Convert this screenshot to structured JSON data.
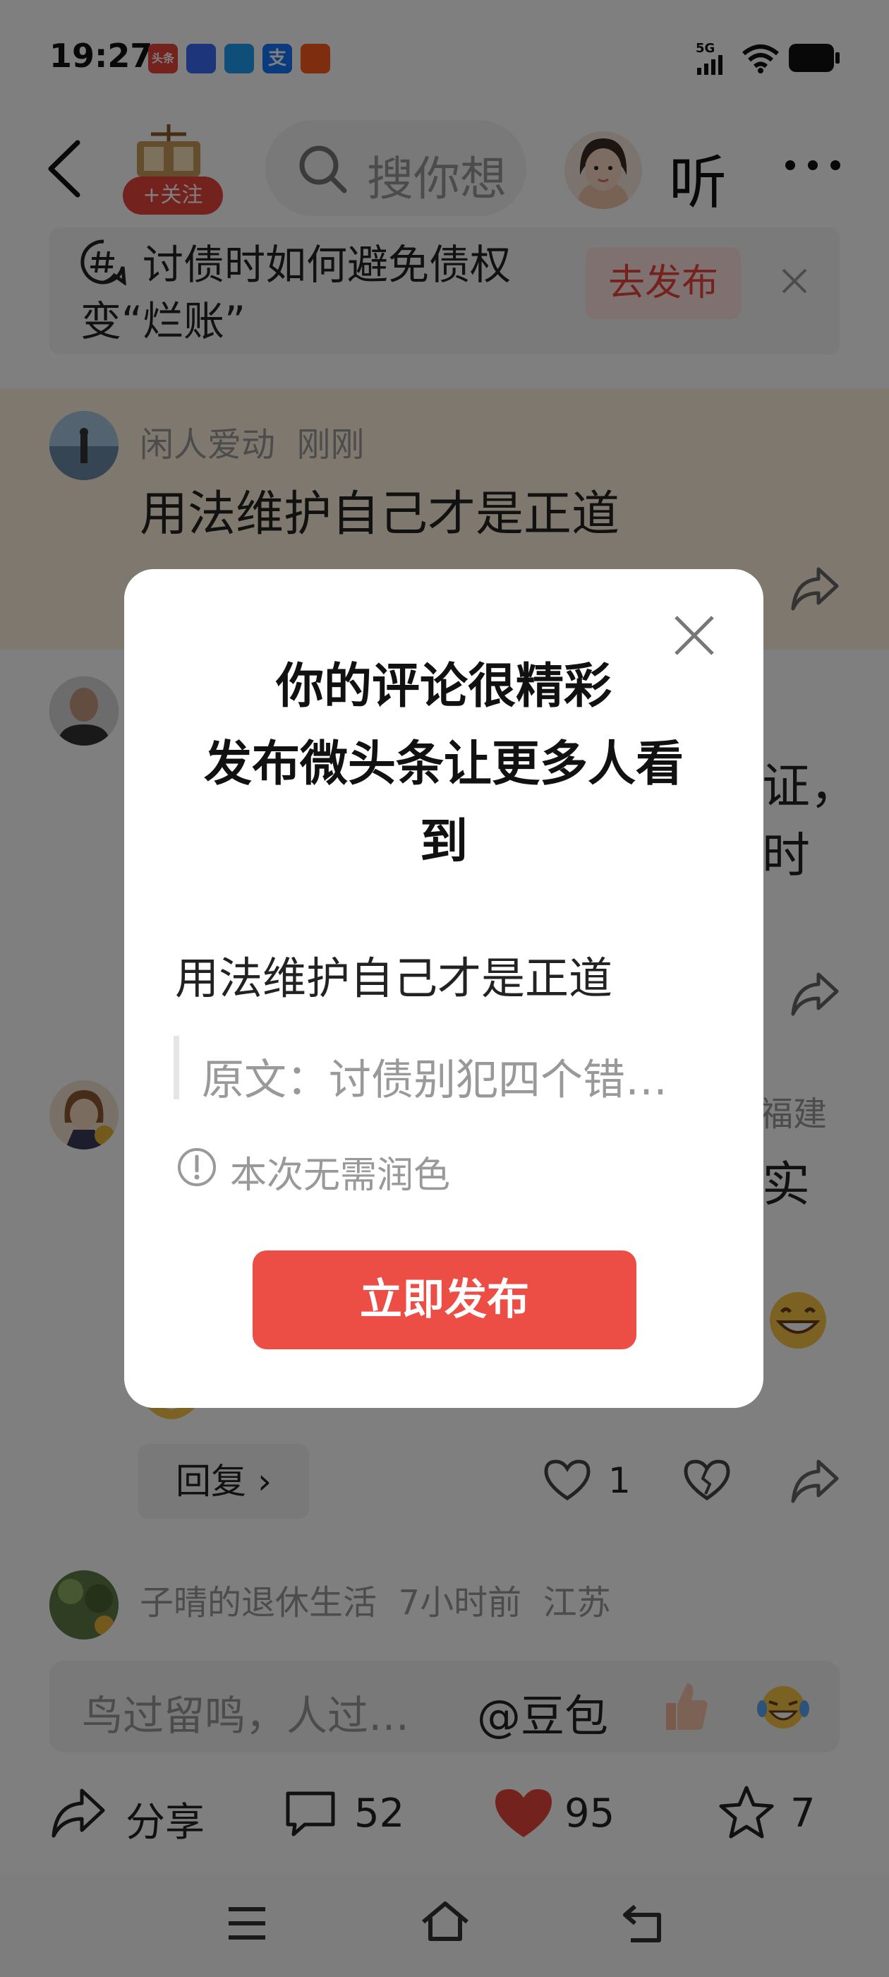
{
  "status_bar": {
    "time": "19:27",
    "network": "5G",
    "app_badges": [
      {
        "name": "toutiao",
        "label": "头条",
        "color": "#e8443a"
      },
      {
        "name": "baidu",
        "label": "",
        "color": "#3b6cf6"
      },
      {
        "name": "msg",
        "label": "",
        "color": "#1f9df0"
      },
      {
        "name": "alipay",
        "label": "支",
        "color": "#1677ff"
      },
      {
        "name": "taobao",
        "label": "",
        "color": "#ff5a1f"
      }
    ]
  },
  "header": {
    "follow_label": "+关注",
    "search_placeholder": "搜你想",
    "listen_label": "听"
  },
  "topic": {
    "text": "讨债时如何避免债权变“烂账”",
    "publish_label": "去发布"
  },
  "comments": [
    {
      "name": "闲人爱动",
      "time": "刚刚",
      "location": "",
      "text": "用法维护自己才是正道"
    },
    {
      "name": "",
      "time": "",
      "location": "",
      "text": "证，",
      "text2": "时"
    },
    {
      "name": "",
      "time": "",
      "location": "福建",
      "text": "实"
    },
    {
      "name": "子晴的退休生活",
      "time": "7小时前",
      "location": "江苏",
      "text": ""
    }
  ],
  "reply": {
    "label": "回复",
    "like_count": "1"
  },
  "input": {
    "placeholder": "鸟过留鸣，人过…",
    "at_label": "@豆包"
  },
  "actions": {
    "share_label": "分享",
    "comment_count": "52",
    "like_count": "95",
    "favorite_count": "7"
  },
  "modal": {
    "title_line1": "你的评论很精彩",
    "title_line2": "发布微头条让更多人看",
    "title_line3": "到",
    "comment": "用法维护自己才是正道",
    "quote": "原文：讨债别犯四个错…",
    "notice": "本次无需润色",
    "button_label": "立即发布"
  },
  "colors": {
    "accent_red": "#e8443a",
    "button_red": "#ec4d44",
    "highlight_bg": "#fff1dc"
  }
}
